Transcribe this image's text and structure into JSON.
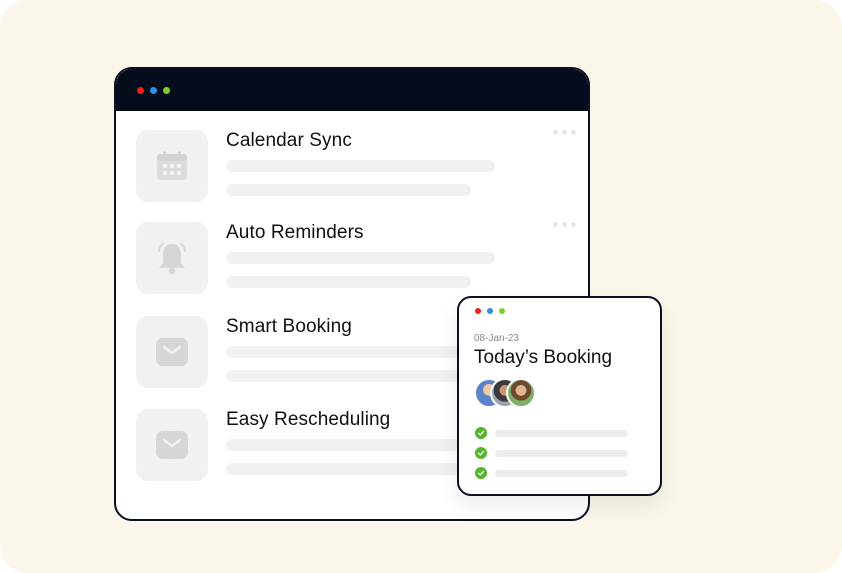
{
  "colors": {
    "background": "#faf7ea",
    "titlebar": "#050c1c",
    "dot_red": "#e5231b",
    "dot_blue": "#2f8fe0",
    "dot_green": "#7ccf2e",
    "check_green": "#55b52f",
    "placeholder": "#f1f1f1"
  },
  "main_window": {
    "features": [
      {
        "title": "Calendar Sync",
        "icon": "calendar-icon",
        "has_menu": true
      },
      {
        "title": "Auto Reminders",
        "icon": "bell-icon",
        "has_menu": true
      },
      {
        "title": "Smart Booking",
        "icon": "mail-icon",
        "has_menu": false
      },
      {
        "title": "Easy Rescheduling",
        "icon": "mail-icon",
        "has_menu": false
      }
    ]
  },
  "booking_card": {
    "date": "08-Jan-23",
    "title": "Today’s Booking",
    "avatars": [
      "avatar-1",
      "avatar-2",
      "avatar-3"
    ],
    "checklist_count": 3
  }
}
